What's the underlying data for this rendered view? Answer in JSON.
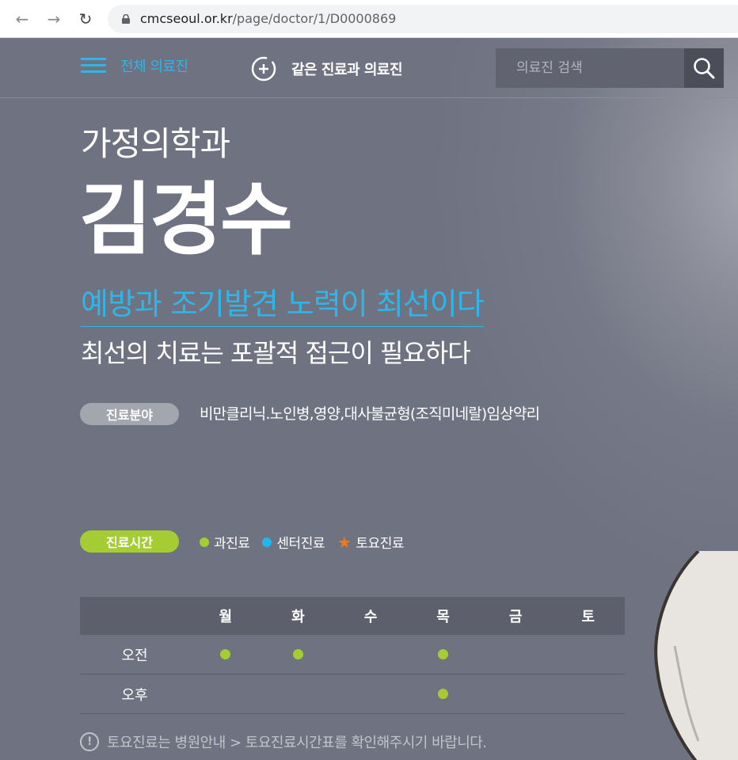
{
  "browser": {
    "url_host": "cmcseoul.or.kr",
    "url_path": "/page/doctor/1/D0000869"
  },
  "nav": {
    "all_doctors": "전체 의료진",
    "same_dept": "같은 진료과 의료진",
    "search_placeholder": "의료진 검색"
  },
  "doctor": {
    "department": "가정의학과",
    "name": "김경수",
    "motto": "예방과 조기발견 노력이 최선이다",
    "sub_motto": "최선의 치료는 포괄적 접근이 필요하다",
    "specialty_label": "진료분야",
    "specialty": "비만클리닉.노인병,영양,대사불균형(조직미네랄)임상약리"
  },
  "hours": {
    "label": "진료시간",
    "legend": {
      "dept": "과진료",
      "center": "센터진료",
      "saturday": "토요진료"
    },
    "days": [
      "월",
      "화",
      "수",
      "목",
      "금",
      "토"
    ],
    "rows": [
      {
        "label": "오전",
        "slots": [
          true,
          true,
          false,
          true,
          false,
          false
        ]
      },
      {
        "label": "오후",
        "slots": [
          false,
          false,
          false,
          true,
          false,
          false
        ]
      }
    ],
    "notice": "토요진료는 병원안내 > 토요진료시간표를 확인해주시기 바랍니다."
  },
  "colors": {
    "accent_blue": "#2fb5e8",
    "accent_green": "#a6cc33",
    "star_orange": "#f07a1a"
  }
}
